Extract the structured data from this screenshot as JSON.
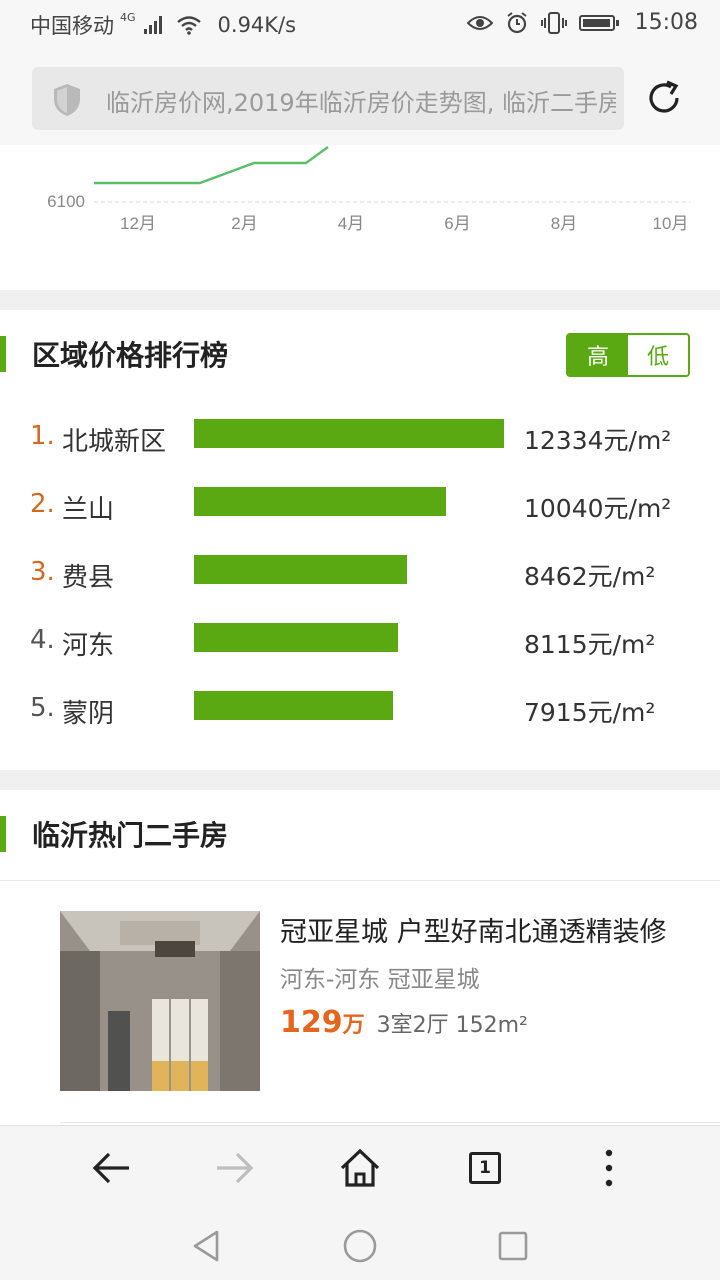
{
  "status_bar": {
    "carrier": "中国移动",
    "network": "4G",
    "net_speed": "0.94K/s",
    "time": "15:08"
  },
  "address_bar": {
    "url_text": "临沂房价网,2019年临沂房价走势图, 临沂二手房"
  },
  "trend_chart": {
    "y_tick": "6100",
    "x_ticks": [
      "12月",
      "2月",
      "4月",
      "6月",
      "8月",
      "10月"
    ],
    "line_color": "#5bbf6a"
  },
  "ranking": {
    "title": "区域价格排行榜",
    "toggle_high": "高",
    "toggle_low": "低",
    "accent_color": "#5aa912",
    "items": [
      {
        "rank": "1.",
        "name": "北城新区",
        "price": "12334元/m²",
        "value": 12334,
        "rank_color": "#d2691e"
      },
      {
        "rank": "2.",
        "name": "兰山",
        "price": "10040元/m²",
        "value": 10040,
        "rank_color": "#d2691e"
      },
      {
        "rank": "3.",
        "name": "费县",
        "price": "8462元/m²",
        "value": 8462,
        "rank_color": "#d2691e"
      },
      {
        "rank": "4.",
        "name": "河东",
        "price": "8115元/m²",
        "value": 8115,
        "rank_color": "#555555"
      },
      {
        "rank": "5.",
        "name": "蒙阴",
        "price": "7915元/m²",
        "value": 7915,
        "rank_color": "#555555"
      }
    ]
  },
  "hot_listings": {
    "title": "临沂热门二手房",
    "items": [
      {
        "title": "冠亚星城 户型好南北通透精装修",
        "location": "河东-河东 冠亚星城",
        "price": "129",
        "price_unit": "万",
        "info": "3室2厅 152m²"
      }
    ]
  },
  "toolbar": {
    "tab_count": "1"
  }
}
